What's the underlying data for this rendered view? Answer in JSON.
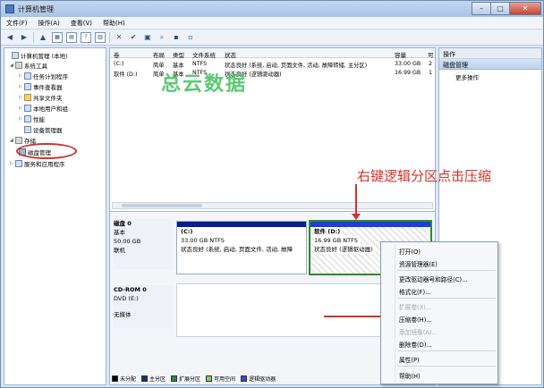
{
  "window": {
    "title": "计算机管理"
  },
  "menubar": [
    "文件(F)",
    "操作(A)",
    "查看(V)",
    "帮助(H)"
  ],
  "tree": {
    "items": [
      {
        "label": "计算机管理 (本地)",
        "icon": "computer-icon"
      },
      {
        "label": "系统工具",
        "icon": "tools-icon"
      },
      {
        "label": "任务计划程序",
        "icon": "clock-icon"
      },
      {
        "label": "事件查看器",
        "icon": "event-icon"
      },
      {
        "label": "共享文件夹",
        "icon": "folder-icon"
      },
      {
        "label": "本地用户和组",
        "icon": "users-icon"
      },
      {
        "label": "性能",
        "icon": "performance-icon"
      },
      {
        "label": "设备管理器",
        "icon": "device-icon"
      },
      {
        "label": "存储",
        "icon": "storage-icon"
      },
      {
        "label": "磁盘管理",
        "icon": "disk-icon"
      },
      {
        "label": "服务和应用程序",
        "icon": "services-icon"
      }
    ]
  },
  "volumes": {
    "headers": [
      "卷",
      "布局",
      "类型",
      "文件系统",
      "状态",
      "容量",
      "可"
    ],
    "rows": [
      {
        "name": "(C:)",
        "layout": "简单",
        "type": "基本",
        "fs": "NTFS",
        "status": "状态良好 (系统, 启动, 页面文件, 活动, 故障转储, 主分区)",
        "capacity": "33.00 GB",
        "free": "2"
      },
      {
        "name": "软件 (D:)",
        "layout": "简单",
        "type": "基本",
        "fs": "NTFS",
        "status": "状态良好 (逻辑驱动器)",
        "capacity": "16.99 GB",
        "free": "1"
      }
    ]
  },
  "disks": [
    {
      "title": "磁盘 0",
      "type": "基本",
      "size": "50.00 GB",
      "state": "联机",
      "partitions": [
        {
          "name": "(C:)",
          "size": "33.00 GB NTFS",
          "status": "状态良好 (系统, 启动, 页面文件, 活动, 故障"
        },
        {
          "name": "软件 (D:)",
          "size": "16.99 GB NTFS",
          "status": "状态良好 (逻辑驱动器)"
        }
      ]
    },
    {
      "title": "CD-ROM 0",
      "type": "DVD (E:)",
      "size": "",
      "state": "无媒体"
    }
  ],
  "legend": [
    {
      "label": "未分配",
      "color": "#000000"
    },
    {
      "label": "主分区",
      "color": "#1a2c8c"
    },
    {
      "label": "扩展分区",
      "color": "#2e8b3e"
    },
    {
      "label": "可用空间",
      "color": "#7fd35a"
    },
    {
      "label": "逻辑驱动器",
      "color": "#2f4fd0"
    }
  ],
  "actions": {
    "header": "操作",
    "section": "磁盘管理",
    "items": [
      "更多操作"
    ]
  },
  "context_menu": {
    "items": [
      {
        "label": "打开(O)",
        "enabled": true
      },
      {
        "label": "资源管理器(E)",
        "enabled": true
      },
      {
        "label": "更改驱动器号和路径(C)...",
        "enabled": true
      },
      {
        "label": "格式化(F)...",
        "enabled": true
      },
      {
        "label": "扩展卷(X)...",
        "enabled": false
      },
      {
        "label": "压缩卷(H)...",
        "enabled": true
      },
      {
        "label": "添加镜像(A)...",
        "enabled": false
      },
      {
        "label": "删除卷(D)...",
        "enabled": true
      },
      {
        "label": "属性(P)",
        "enabled": true
      },
      {
        "label": "帮助(H)",
        "enabled": true
      }
    ]
  },
  "annotation": "右键逻辑分区点击压缩",
  "watermark": "总云数据",
  "colors": {
    "accent_red": "#d5302a",
    "watermark_green": "#40be5a",
    "primary_partition": "#0a1f8c",
    "logical_drive": "#1e3fd6"
  }
}
